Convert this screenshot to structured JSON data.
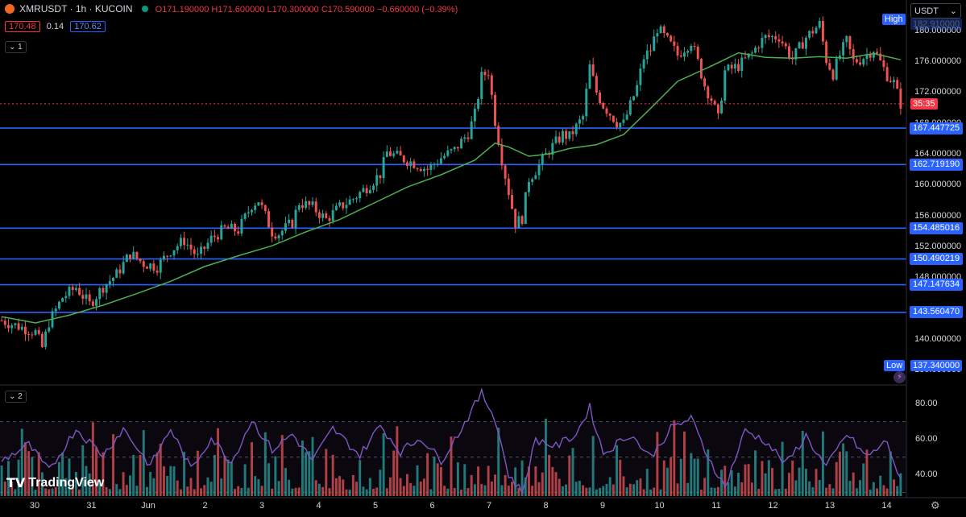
{
  "header": {
    "symbol": "XMRUSDT · 1h · KUCOIN",
    "open": "O171.190000",
    "high": "H171.600000",
    "low": "L170.300000",
    "close": "C170.590000",
    "change": "−0.660000 (−0.39%)",
    "bid": "170.48",
    "spread": "0.14",
    "ask": "170.62",
    "pane1_index": "1",
    "pane2_index": "2",
    "currency": "USDT"
  },
  "labels": {
    "high_tag": "High",
    "low_tag": "Low",
    "high_value": "182.910000",
    "low_value": "137.340000",
    "countdown": "35:35",
    "brand": "TradingView"
  },
  "chart_data": [
    {
      "type": "candlestick",
      "title": "XMRUSDT · 1h · KUCOIN",
      "ylim": [
        135,
        183
      ],
      "y_ticks": [
        "180.000000",
        "176.000000",
        "172.000000",
        "168.000000",
        "164.000000",
        "160.000000",
        "156.000000",
        "152.000000",
        "148.000000",
        "140.000000",
        "136.000000"
      ],
      "x_ticks": [
        "30",
        "31",
        "Jun",
        "2",
        "3",
        "4",
        "5",
        "6",
        "7",
        "8",
        "9",
        "10",
        "11",
        "12",
        "13",
        "14"
      ],
      "close_path": [
        [
          0,
          142.5
        ],
        [
          10,
          141.0
        ],
        [
          12,
          139.0
        ],
        [
          14,
          142.3
        ],
        [
          18,
          145.5
        ],
        [
          22,
          146.8
        ],
        [
          26,
          144.6
        ],
        [
          30,
          146.9
        ],
        [
          34,
          148.5
        ],
        [
          38,
          151.2
        ],
        [
          42,
          149.9
        ],
        [
          46,
          149.5
        ],
        [
          50,
          151.6
        ],
        [
          54,
          152.9
        ],
        [
          58,
          150.7
        ],
        [
          62,
          153.1
        ],
        [
          66,
          154.4
        ],
        [
          70,
          154.2
        ],
        [
          74,
          157.5
        ],
        [
          76,
          158.1
        ],
        [
          80,
          154.0
        ],
        [
          82,
          153.8
        ],
        [
          86,
          155.2
        ],
        [
          88,
          157.8
        ],
        [
          92,
          157.2
        ],
        [
          96,
          155.6
        ],
        [
          100,
          157.2
        ],
        [
          104,
          158.3
        ],
        [
          108,
          159.8
        ],
        [
          112,
          161.5
        ],
        [
          114,
          164.3
        ],
        [
          118,
          163.6
        ],
        [
          122,
          162.9
        ],
        [
          126,
          162.1
        ],
        [
          130,
          163.6
        ],
        [
          134,
          164.6
        ],
        [
          138,
          166.8
        ],
        [
          140,
          169.2
        ],
        [
          142,
          174.1
        ],
        [
          144,
          174.8
        ],
        [
          146,
          168.4
        ],
        [
          148,
          163.4
        ],
        [
          150,
          159.2
        ],
        [
          152,
          155.1
        ],
        [
          154,
          155.8
        ],
        [
          156,
          160.9
        ],
        [
          158,
          162.0
        ],
        [
          162,
          164.6
        ],
        [
          166,
          166.6
        ],
        [
          168,
          166.3
        ],
        [
          172,
          168.9
        ],
        [
          174,
          175.4
        ],
        [
          176,
          172.1
        ],
        [
          178,
          170.4
        ],
        [
          182,
          168.2
        ],
        [
          184,
          168.0
        ],
        [
          188,
          172.8
        ],
        [
          190,
          176.6
        ],
        [
          192,
          177.6
        ],
        [
          194,
          180.4
        ],
        [
          198,
          178.2
        ],
        [
          200,
          176.9
        ],
        [
          204,
          178.7
        ],
        [
          206,
          176.0
        ],
        [
          208,
          173.0
        ],
        [
          210,
          171.2
        ],
        [
          212,
          168.6
        ],
        [
          214,
          174.8
        ],
        [
          218,
          175.5
        ],
        [
          222,
          177.1
        ],
        [
          224,
          178.4
        ],
        [
          226,
          179.2
        ],
        [
          230,
          179.3
        ],
        [
          234,
          176.4
        ],
        [
          238,
          179.2
        ],
        [
          242,
          180.9
        ],
        [
          244,
          176.3
        ],
        [
          246,
          174.5
        ],
        [
          248,
          176.9
        ],
        [
          250,
          178.7
        ],
        [
          252,
          176.1
        ],
        [
          254,
          176.3
        ],
        [
          258,
          177.7
        ],
        [
          262,
          174.3
        ],
        [
          264,
          173.3
        ],
        [
          266,
          170.6
        ]
      ],
      "series": [
        {
          "name": "",
          "kind": "moving-average",
          "color": "#4caf50",
          "values": [
            [
              0,
              143.0
            ],
            [
              10,
              142.2
            ],
            [
              20,
              143.2
            ],
            [
              30,
              144.5
            ],
            [
              40,
              146.0
            ],
            [
              50,
              147.6
            ],
            [
              60,
              149.5
            ],
            [
              70,
              150.9
            ],
            [
              80,
              152.2
            ],
            [
              90,
              154.0
            ],
            [
              100,
              155.6
            ],
            [
              110,
              157.7
            ],
            [
              120,
              159.8
            ],
            [
              130,
              161.4
            ],
            [
              140,
              163.3
            ],
            [
              146,
              165.5
            ],
            [
              150,
              165.0
            ],
            [
              156,
              163.8
            ],
            [
              162,
              164.1
            ],
            [
              168,
              164.8
            ],
            [
              176,
              165.3
            ],
            [
              184,
              166.6
            ],
            [
              192,
              170.0
            ],
            [
              200,
              173.5
            ],
            [
              210,
              175.5
            ],
            [
              218,
              177.2
            ],
            [
              226,
              176.6
            ],
            [
              234,
              176.5
            ],
            [
              242,
              176.7
            ],
            [
              250,
              176.5
            ],
            [
              258,
              177.1
            ],
            [
              266,
              176.3
            ]
          ]
        },
        {
          "name": "",
          "kind": "horizontal-levels",
          "color": "#2962ff",
          "values": [
            167.447725,
            162.71919,
            154.485016,
            150.490219,
            147.147634,
            143.56047
          ],
          "labels": [
            "167.447725",
            "162.719190",
            "154.485016",
            "150.490219",
            "147.147634",
            "143.560470"
          ]
        }
      ],
      "last_price": 170.59,
      "bar_count": 267,
      "session_high": 182.91,
      "session_low": 137.34
    },
    {
      "type": "line",
      "title": "",
      "ylim": [
        28,
        88
      ],
      "y_ticks": [
        "80.00",
        "60.00",
        "40.00"
      ],
      "guide_levels": [
        70,
        50,
        30
      ],
      "series": [
        {
          "name": "",
          "color": "#7e57c2",
          "values": [
            [
              0,
              48
            ],
            [
              8,
              57
            ],
            [
              14,
              42
            ],
            [
              22,
              66
            ],
            [
              30,
              51
            ],
            [
              36,
              66
            ],
            [
              44,
              45
            ],
            [
              50,
              66
            ],
            [
              56,
              43
            ],
            [
              62,
              61
            ],
            [
              68,
              47
            ],
            [
              74,
              71
            ],
            [
              80,
              54
            ],
            [
              86,
              63
            ],
            [
              92,
              48
            ],
            [
              98,
              66
            ],
            [
              106,
              51
            ],
            [
              112,
              68
            ],
            [
              118,
              53
            ],
            [
              124,
              61
            ],
            [
              130,
              48
            ],
            [
              136,
              66
            ],
            [
              142,
              86
            ],
            [
              146,
              72
            ],
            [
              150,
              40
            ],
            [
              154,
              30
            ],
            [
              158,
              60
            ],
            [
              164,
              56
            ],
            [
              170,
              63
            ],
            [
              174,
              78
            ],
            [
              178,
              52
            ],
            [
              186,
              63
            ],
            [
              192,
              50
            ],
            [
              198,
              66
            ],
            [
              204,
              72
            ],
            [
              208,
              54
            ],
            [
              214,
              33
            ],
            [
              220,
              65
            ],
            [
              226,
              59
            ],
            [
              232,
              46
            ],
            [
              238,
              62
            ],
            [
              244,
              44
            ],
            [
              250,
              63
            ],
            [
              256,
              50
            ],
            [
              262,
              59
            ],
            [
              266,
              36
            ]
          ]
        }
      ],
      "volume_bars": {
        "kind": "histogram",
        "colors": [
          "#26a69a",
          "#ef5350"
        ]
      }
    }
  ]
}
